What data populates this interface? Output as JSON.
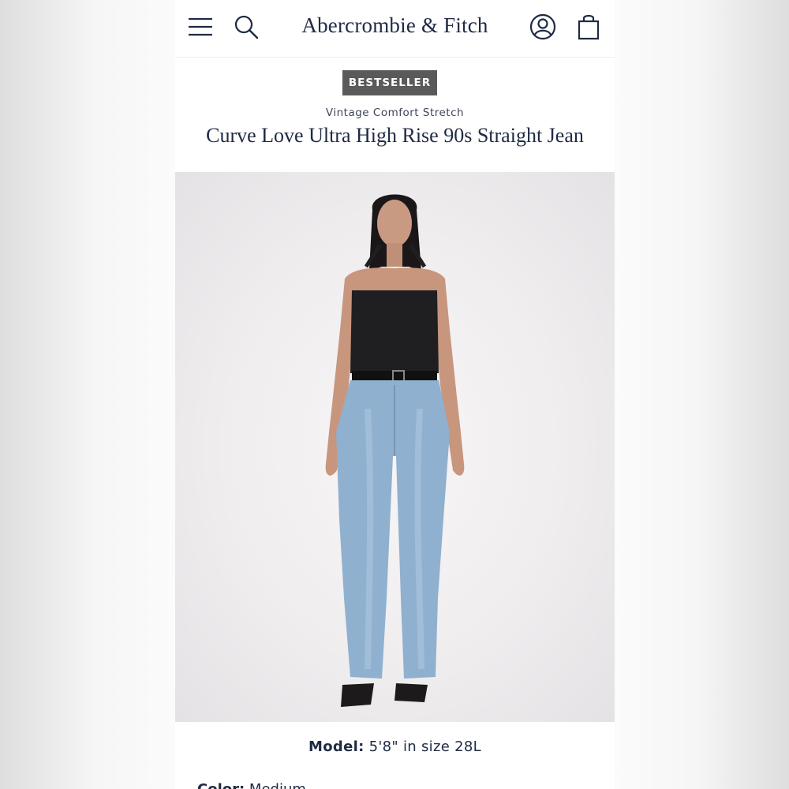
{
  "header": {
    "brand": "Abercrombie & Fitch",
    "menu_icon": "menu-icon",
    "search_icon": "search-icon",
    "account_icon": "account-icon",
    "bag_icon": "shopping-bag-icon"
  },
  "product": {
    "badge": "BESTSELLER",
    "collection": "Vintage Comfort Stretch",
    "title": "Curve Love Ultra High Rise 90s Straight Jean"
  },
  "model": {
    "label": "Model:",
    "value": "5'8\" in size 28L"
  },
  "color": {
    "label": "Color:",
    "value": "Medium"
  },
  "colors": {
    "brand_navy": "#1f2a44",
    "badge_bg": "#5a5a5a"
  }
}
